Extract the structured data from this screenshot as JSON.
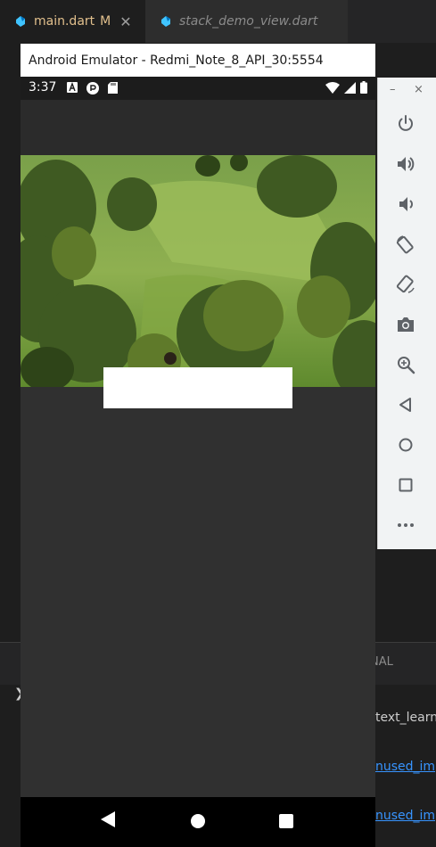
{
  "editor": {
    "tabs": [
      {
        "label": "main.dart",
        "modified": "M",
        "close": "✕",
        "icon": "dart-icon"
      },
      {
        "label": "stack_demo_view.dart",
        "icon": "dart-icon"
      }
    ],
    "panel_tab_partial": "NAL",
    "terminal": {
      "line1": "text_learn_",
      "line2": "nused_imp",
      "line3": "nused_imp"
    }
  },
  "emulator": {
    "title": "Android Emulator - Redmi_Note_8_API_30:5554",
    "status_bar": {
      "time": "3:37",
      "left_icons": [
        "accessibility-a-icon",
        "notification-icon",
        "sd-card-icon"
      ],
      "right_icons": [
        "wifi-icon",
        "signal-icon",
        "battery-icon"
      ]
    },
    "hero_image": "hillside-landscape-photo",
    "nav_bar": [
      "back-triangle-icon",
      "home-circle-icon",
      "recents-square-icon"
    ],
    "toolbar": {
      "window_controls": {
        "minimize": "–",
        "close": "×"
      },
      "buttons": [
        "power-icon",
        "volume-up-icon",
        "volume-down-icon",
        "rotate-left-icon",
        "rotate-right-icon",
        "camera-icon",
        "zoom-icon",
        "back-icon",
        "home-icon",
        "overview-icon",
        "more-icon"
      ]
    }
  },
  "colors": {
    "editor_bg": "#1e1e1e",
    "tab_modified": "#e2c08d",
    "link": "#3794ff",
    "app_bg": "#303030",
    "toolbar_bg": "#f1f3f4",
    "toolbar_icon": "#5f6368"
  }
}
